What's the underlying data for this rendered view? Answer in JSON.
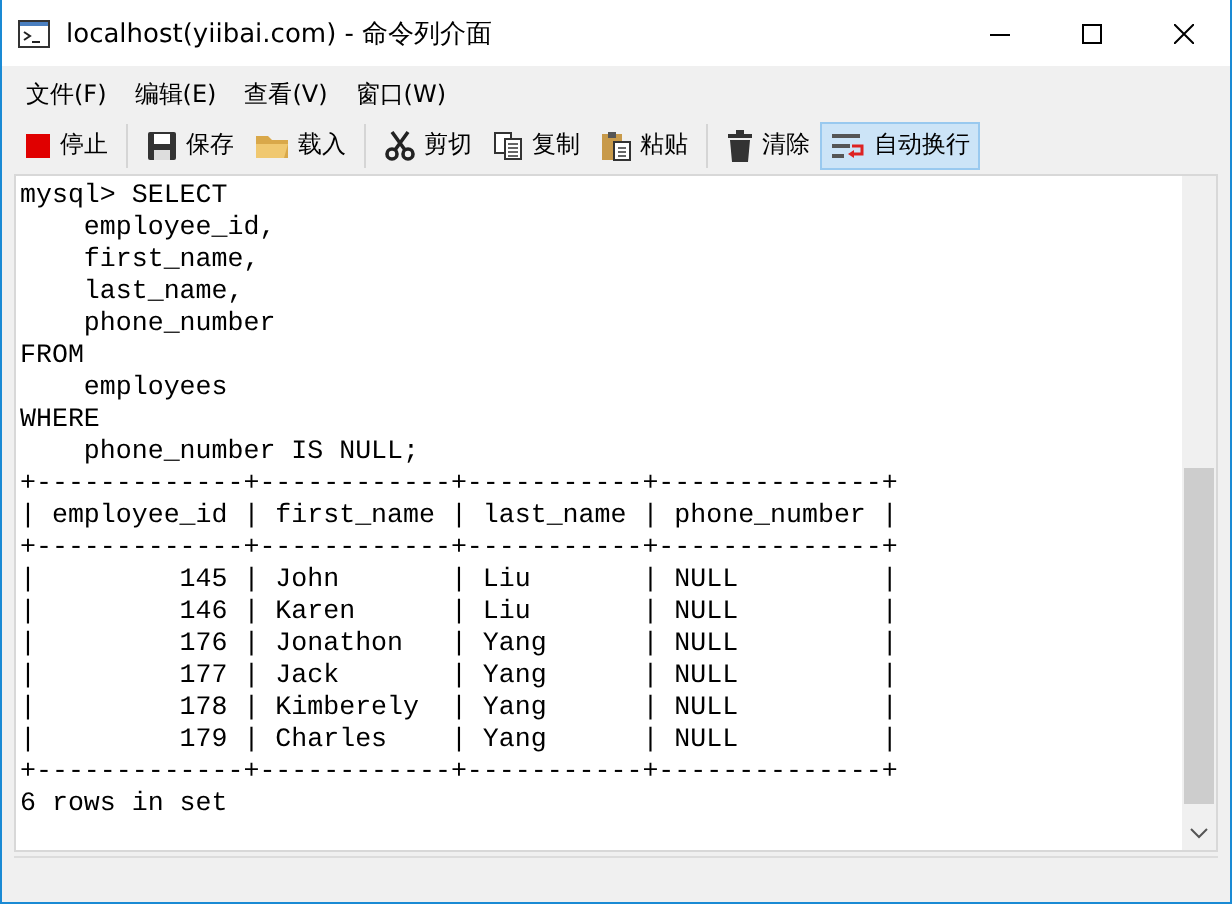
{
  "window": {
    "title": "localhost(yiibai.com) - 命令列介面"
  },
  "menu": [
    "文件(F)",
    "编辑(E)",
    "查看(V)",
    "窗口(W)"
  ],
  "toolbar": [
    {
      "kind": "stop",
      "label": "停止",
      "on": false
    },
    {
      "kind": "sep"
    },
    {
      "kind": "save",
      "label": "保存",
      "on": false
    },
    {
      "kind": "load",
      "label": "载入",
      "on": false
    },
    {
      "kind": "sep"
    },
    {
      "kind": "cut",
      "label": "剪切",
      "on": false
    },
    {
      "kind": "copy",
      "label": "复制",
      "on": false
    },
    {
      "kind": "paste",
      "label": "粘贴",
      "on": false
    },
    {
      "kind": "sep"
    },
    {
      "kind": "clear",
      "label": "清除",
      "on": false
    },
    {
      "kind": "wrap",
      "label": "自动换行",
      "on": true
    }
  ],
  "console": {
    "lines": [
      "mysql> SELECT",
      "    employee_id,",
      "    first_name,",
      "    last_name,",
      "    phone_number",
      "FROM",
      "    employees",
      "WHERE",
      "    phone_number IS NULL;",
      "+-------------+------------+-----------+--------------+",
      "| employee_id | first_name | last_name | phone_number |",
      "+-------------+------------+-----------+--------------+",
      "|         145 | John       | Liu       | NULL         |",
      "|         146 | Karen      | Liu       | NULL         |",
      "|         176 | Jonathon   | Yang      | NULL         |",
      "|         177 | Jack       | Yang      | NULL         |",
      "|         178 | Kimberely  | Yang      | NULL         |",
      "|         179 | Charles    | Yang      | NULL         |",
      "+-------------+------------+-----------+--------------+",
      "6 rows in set"
    ]
  }
}
